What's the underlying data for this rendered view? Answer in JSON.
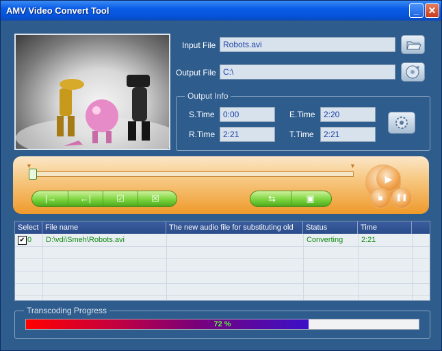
{
  "window": {
    "title": "AMV Video Convert Tool",
    "min_glyph": "_",
    "close_glyph": "✕"
  },
  "files": {
    "input_label": "Input File",
    "input_value": "Robots.avi",
    "output_label": "Output File",
    "output_value": "C:\\"
  },
  "output_info": {
    "legend": "Output Info",
    "s_time_label": "S.Time",
    "s_time": "0:00",
    "e_time_label": "E.Time",
    "e_time": "2:20",
    "r_time_label": "R.Time",
    "r_time": "2:21",
    "t_time_label": "T.Time",
    "t_time": "2:21"
  },
  "controls": {
    "left_buttons": [
      "set-start",
      "set-end",
      "check",
      "cross"
    ],
    "left_glyphs": [
      "|→",
      "←|",
      "☑",
      "☒"
    ],
    "right_buttons": [
      "swap",
      "fit"
    ],
    "right_glyphs": [
      "⇆",
      "▣"
    ],
    "play_glyph": "▶",
    "stop_glyph": "■",
    "pause_glyph": "❚❚"
  },
  "table": {
    "columns": [
      "Select",
      "File name",
      "The new audio file for substituting old",
      "Status",
      "Time"
    ],
    "rows": [
      {
        "select": "0",
        "checked": true,
        "file": "D:\\vdi\\Smeh\\Robots.avi",
        "audio": "",
        "status": "Converting",
        "time": "2:21"
      }
    ]
  },
  "progress": {
    "legend": "Transcoding Progress",
    "text": "72 %",
    "value": 72
  },
  "colors": {
    "titlebar": "#0a5ce6",
    "panel": "#2e5c8d",
    "accent_orange": "#ef9a2a",
    "green_text": "#0f8a0f"
  }
}
